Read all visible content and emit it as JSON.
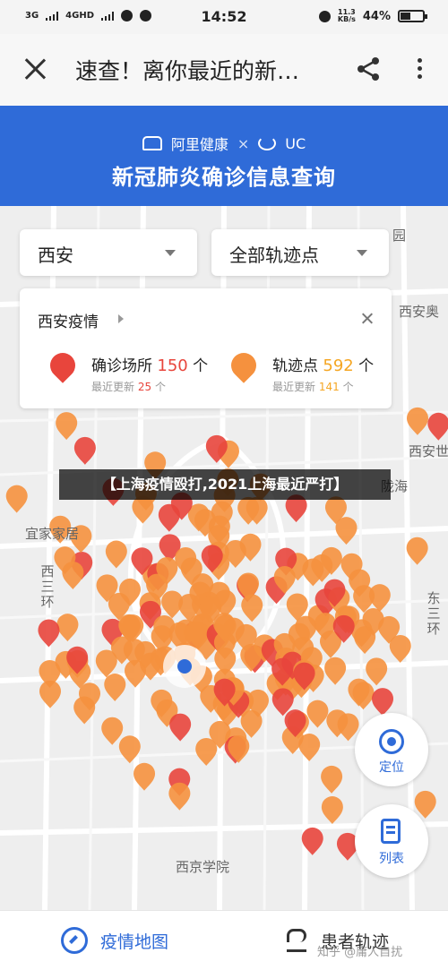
{
  "status_bar": {
    "network_1": "3G",
    "network_2": "4GHD",
    "time": "14:52",
    "net_speed_value": "11.3",
    "net_speed_unit": "KB/s",
    "battery": "44%",
    "battery_fraction": 0.44
  },
  "header": {
    "title": "速查！离你最近的新…",
    "close_icon": "close-icon",
    "share_icon": "share-icon",
    "more_icon": "more-vertical-icon"
  },
  "banner": {
    "brand_1": "阿里健康",
    "separator": "×",
    "brand_2": "UC",
    "title": "新冠肺炎确诊信息查询",
    "background_color": "#2f6bd8"
  },
  "filters": {
    "city": "西安",
    "type": "全部轨迹点"
  },
  "info_card": {
    "title": "西安疫情",
    "confirmed": {
      "label": "确诊场所",
      "count": "150",
      "unit": "个",
      "recent_label": "最近更新",
      "recent_count": "25",
      "recent_unit": "个",
      "color": "#e8453c"
    },
    "trajectory": {
      "label": "轨迹点",
      "count": "592",
      "unit": "个",
      "recent_label": "最近更新",
      "recent_count": "141",
      "recent_unit": "个",
      "color": "#f5913e"
    }
  },
  "overlay_caption": "【上海疫情殴打,2021上海最近严打】",
  "map_labels": {
    "park": "园",
    "xian_top_right": "西安奥",
    "xian_right": "西安世",
    "longhai": "陇海",
    "home": "宜家家居",
    "ring_west": "西三环",
    "ring_east": "东三环",
    "school": "西京学院"
  },
  "fabs": {
    "locate": "定位",
    "list": "列表"
  },
  "bottom_nav": {
    "tab_map": "疫情地图",
    "tab_patients": "患者轨迹",
    "active_color": "#2f6bd8"
  },
  "watermark": "知乎 @庸人自扰"
}
